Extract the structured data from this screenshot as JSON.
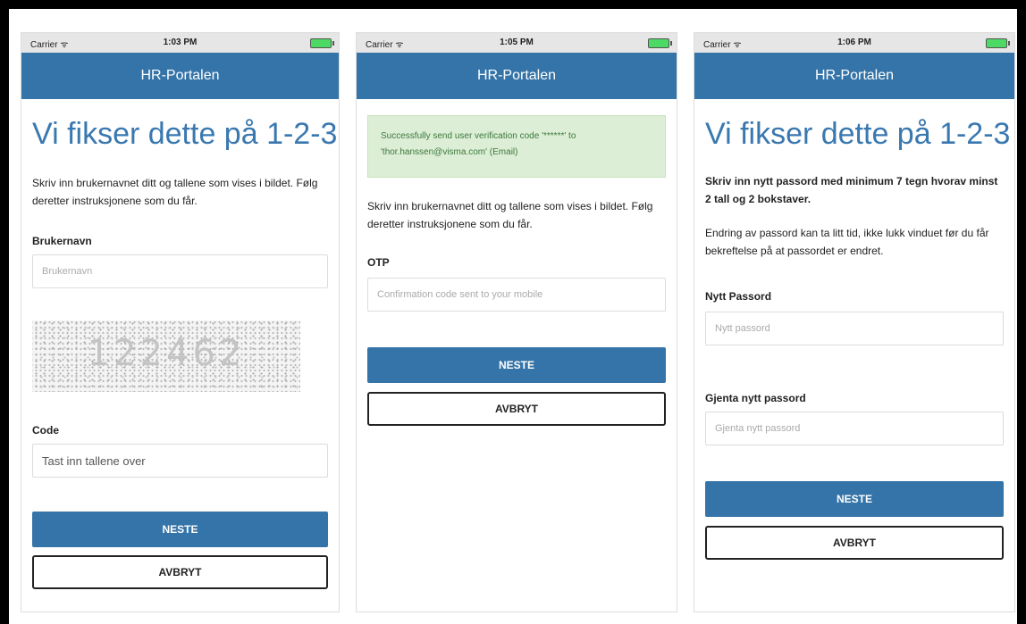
{
  "screens": [
    {
      "status": {
        "carrier": "Carrier ᯤ",
        "time": "1:03 PM"
      },
      "nav_title": "HR-Portalen",
      "heading": "Vi fikser dette på 1-2-3",
      "intro": "Skriv inn brukernavnet ditt og tallene som vises i bildet. Følg deretter instruksjonene som du får.",
      "username_label": "Brukernavn",
      "username_placeholder": "Brukernavn",
      "captcha_text": "122462",
      "code_label": "Code",
      "code_value": "Tast inn tallene over",
      "next_label": "NESTE",
      "cancel_label": "AVBRYT"
    },
    {
      "status": {
        "carrier": "Carrier ᯤ",
        "time": "1:05 PM"
      },
      "nav_title": "HR-Portalen",
      "alert": "Successfully send user verification code '******' to 'thor.hanssen@visma.com' (Email)",
      "intro": "Skriv inn brukernavnet ditt og tallene som vises i bildet. Følg deretter instruksjonene som du får.",
      "otp_label": "OTP",
      "otp_placeholder": "Confirmation code sent to your mobile",
      "next_label": "NESTE",
      "cancel_label": "AVBRYT"
    },
    {
      "status": {
        "carrier": "Carrier ᯤ",
        "time": "1:06 PM"
      },
      "nav_title": "HR-Portalen",
      "heading": "Vi fikser dette på 1-2-3",
      "instruction": "Skriv inn nytt passord med minimum 7 tegn hvorav minst 2 tall og 2 bokstaver.",
      "note": "Endring av passord kan ta litt tid, ikke lukk vinduet før du får bekreftelse på at passordet er endret.",
      "new_password_label": "Nytt Passord",
      "new_password_placeholder": "Nytt passord",
      "repeat_password_label": "Gjenta nytt passord",
      "repeat_password_placeholder": "Gjenta nytt passord",
      "next_label": "NESTE",
      "cancel_label": "AVBRYT"
    }
  ],
  "colors": {
    "accent": "#3574a8",
    "heading": "#3a78b0",
    "success_bg": "#dcefd6",
    "battery": "#4cd964"
  },
  "icons": {
    "wifi": "wifi-icon",
    "battery": "battery-icon"
  }
}
